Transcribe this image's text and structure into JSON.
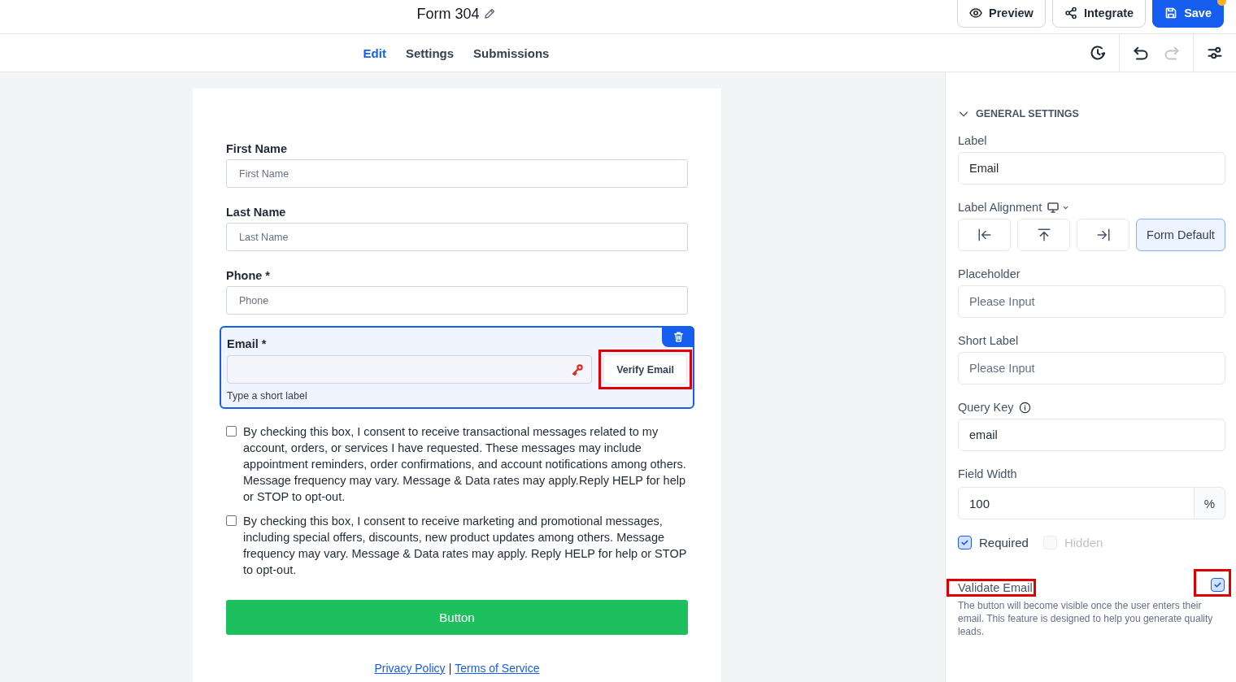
{
  "header": {
    "title": "Form 304",
    "buttons": [
      {
        "label": "Preview",
        "kind": "preview",
        "primary": false,
        "unsaved": false
      },
      {
        "label": "Integrate",
        "kind": "integrate",
        "primary": false,
        "unsaved": false
      },
      {
        "label": "Save",
        "kind": "save",
        "primary": true,
        "unsaved": true
      }
    ]
  },
  "tabs": [
    {
      "label": "Edit",
      "selected": true
    },
    {
      "label": "Settings",
      "selected": false
    },
    {
      "label": "Submissions",
      "selected": false
    }
  ],
  "toolbar": [
    {
      "kind": "history",
      "disabled": false
    },
    {
      "kind": "undo",
      "disabled": false
    },
    {
      "kind": "redo",
      "disabled": true
    },
    {
      "kind": "settings",
      "disabled": false
    }
  ],
  "form": {
    "required_mark": "*",
    "fields": [
      {
        "kind": "text",
        "label": "First Name",
        "required": false,
        "placeholder": "First Name",
        "selected": false
      },
      {
        "kind": "text",
        "label": "Last Name",
        "required": false,
        "placeholder": "Last Name",
        "selected": false
      },
      {
        "kind": "text",
        "label": "Phone",
        "required": true,
        "placeholder": "Phone",
        "selected": false
      },
      {
        "kind": "email",
        "label": "Email",
        "required": true,
        "selected": true,
        "short_label": "Type a short label",
        "verify_button": "Verify Email",
        "verify_highlighted": true
      }
    ],
    "consents": [
      {
        "text": "By checking this box, I consent to receive transactional messages related to my account, orders, or services I have requested. These messages may include appointment reminders, order confirmations, and account notifications among others. Message frequency may vary. Message & Data rates may apply.Reply HELP for help or STOP to opt-out.",
        "checked": false
      },
      {
        "text": "By checking this box, I consent to receive marketing and promotional messages, including special offers, discounts, new product updates among others. Message frequency may vary. Message & Data rates may apply. Reply HELP for help or STOP to opt-out.",
        "checked": false
      }
    ],
    "submit_button": "Button",
    "footer_links": [
      "Privacy Policy",
      "Terms of Service"
    ],
    "footer_separator": "|"
  },
  "panel": {
    "section": {
      "title": "GENERAL SETTINGS",
      "expanded": true
    },
    "label": {
      "title": "Label",
      "value": "Email"
    },
    "label_alignment": {
      "title": "Label Alignment",
      "options": [
        {
          "kind": "left",
          "selected": false
        },
        {
          "kind": "top",
          "selected": false
        },
        {
          "kind": "right",
          "selected": false
        },
        {
          "kind": "default",
          "label": "Form Default",
          "selected": true
        }
      ]
    },
    "placeholder": {
      "title": "Placeholder",
      "placeholder": "Please Input"
    },
    "short_label": {
      "title": "Short Label",
      "placeholder": "Please Input"
    },
    "query_key": {
      "title": "Query Key",
      "value": "email"
    },
    "field_width": {
      "title": "Field Width",
      "value": "100",
      "unit": "%"
    },
    "options": [
      {
        "label": "Required",
        "checked": true,
        "disabled": false
      },
      {
        "label": "Hidden",
        "checked": false,
        "disabled": true
      }
    ],
    "validate_email": {
      "label": "Validate Email",
      "checked": true,
      "highlighted": true,
      "description": "The button will become visible once the user enters their email. This feature is designed to help you generate quality leads."
    }
  }
}
